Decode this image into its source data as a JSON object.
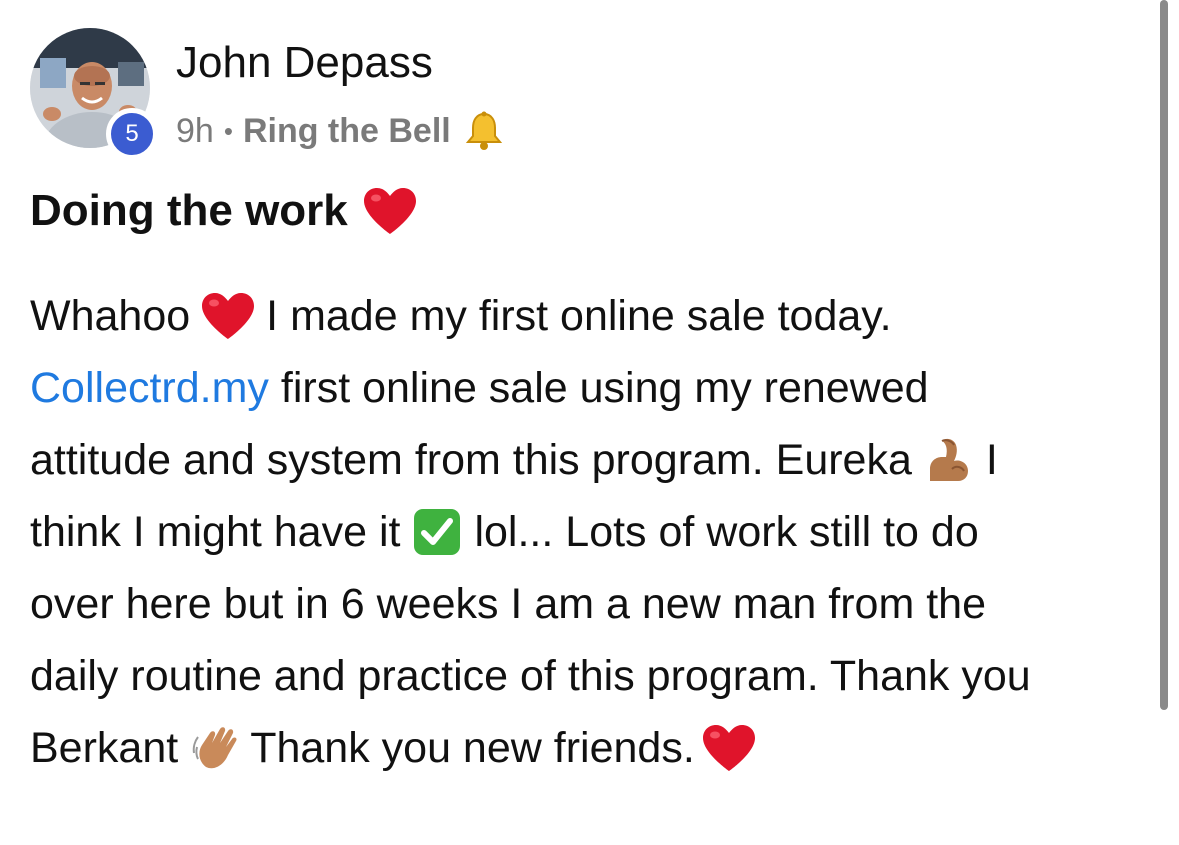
{
  "post": {
    "author": {
      "name": "John Depass",
      "level": "5"
    },
    "meta": {
      "time": "9h",
      "separator": "•",
      "category": "Ring the Bell",
      "category_icon": "bell-emoji"
    },
    "title": {
      "text": "Doing the work",
      "emoji": "red-heart-emoji"
    },
    "body": {
      "l1_a": "Whahoo",
      "l1_b": "I made my first online sale today.",
      "l2_link": "Collectrd.my",
      "l2_b": " first online sale using my renewed",
      "l3_a": "attitude and system from this program. Eureka",
      "l3_b": "I",
      "l4_a": "think I might have it",
      "l4_b": "lol... Lots of work still to do",
      "l5": "over here but in 6 weeks I am a new man from the",
      "l6": "daily routine and practice of this program. Thank you",
      "l7_a": "Berkant",
      "l7_b": "Thank you new friends."
    },
    "emojis": [
      "red-heart-emoji",
      "flexed-biceps-emoji",
      "check-mark-button-emoji",
      "waving-hand-emoji",
      "red-heart-emoji"
    ]
  },
  "colors": {
    "link": "#1f7ae0",
    "badge": "#3b5cd1",
    "meta_text": "#7a7a7a",
    "text": "#111111"
  }
}
